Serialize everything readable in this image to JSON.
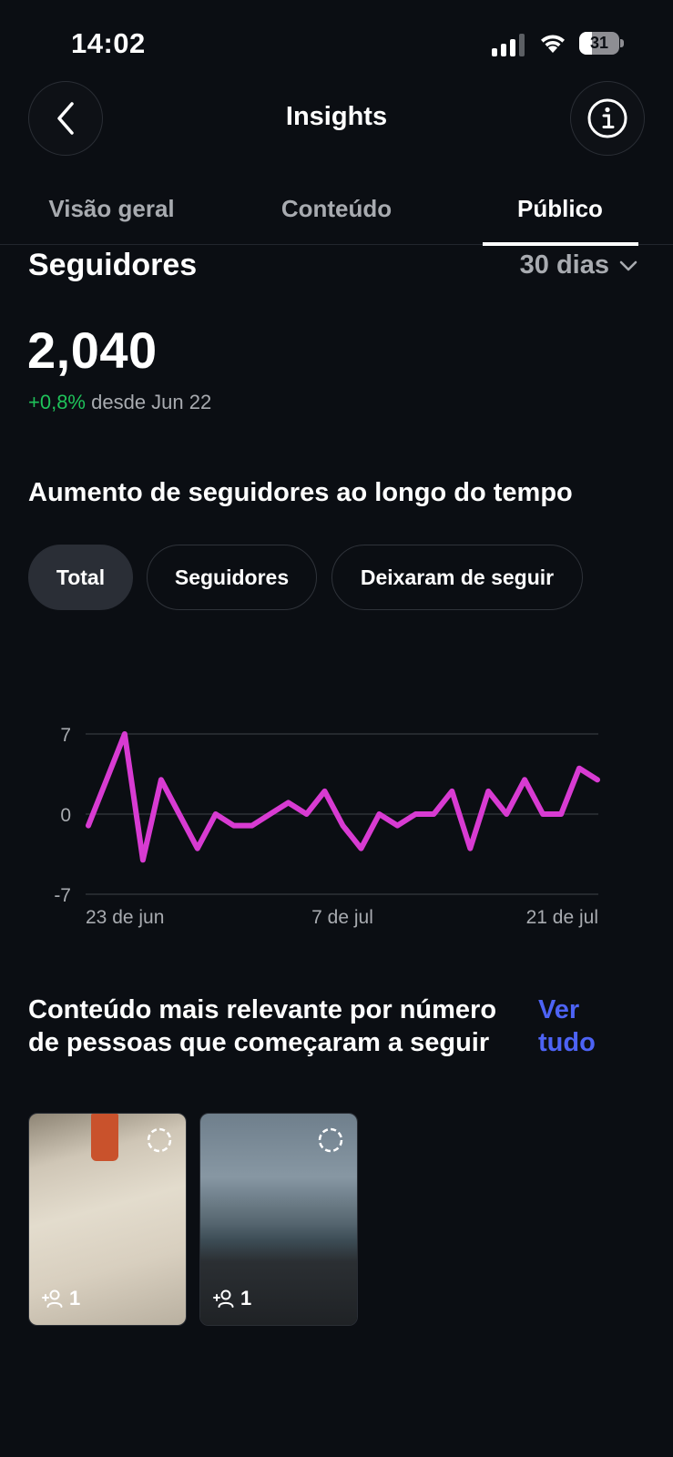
{
  "status_bar": {
    "time": "14:02",
    "battery_level": "31",
    "battery_fraction": 0.31
  },
  "header": {
    "title": "Insights",
    "back_icon": "chevron-left-icon",
    "info_icon": "info-icon"
  },
  "tabs": [
    {
      "label": "Visão geral",
      "active": false
    },
    {
      "label": "Conteúdo",
      "active": false
    },
    {
      "label": "Público",
      "active": true
    }
  ],
  "followers": {
    "title": "Seguidores",
    "period": "30 dias",
    "count": "2,040",
    "delta_value": "+0,8%",
    "delta_text": "desde Jun 22"
  },
  "growth": {
    "title": "Aumento de seguidores ao longo do tempo",
    "filters": [
      {
        "label": "Total",
        "active": true
      },
      {
        "label": "Seguidores",
        "active": false
      },
      {
        "label": "Deixaram de seguir",
        "active": false
      }
    ]
  },
  "chart_data": {
    "type": "line",
    "title": "",
    "xlabel": "",
    "ylabel": "",
    "ylim": [
      -7,
      7
    ],
    "yticks": [
      "7",
      "0",
      "-7"
    ],
    "xticks": [
      "23 de jun",
      "7 de jul",
      "21 de jul"
    ],
    "grid": true,
    "series": [
      {
        "color": "#d83bd2",
        "values": [
          -1,
          3,
          7,
          -4,
          3,
          0,
          -3,
          0,
          -1,
          -1,
          0,
          1,
          0,
          2,
          -1,
          -3,
          0,
          -1,
          0,
          0,
          2,
          -3,
          2,
          0,
          3,
          0,
          0,
          4,
          3
        ]
      }
    ]
  },
  "relevant": {
    "title": "Conteúdo mais relevante por número de pessoas que começaram a seguir",
    "see_all": "Ver tudo",
    "items": [
      {
        "follows": "1",
        "icon": "add-person-icon"
      },
      {
        "follows": "1",
        "icon": "add-person-icon"
      }
    ]
  },
  "colors": {
    "accent": "#4d63f5",
    "positive": "#1fc25a",
    "line": "#d83bd2",
    "background": "#0b0e13"
  }
}
